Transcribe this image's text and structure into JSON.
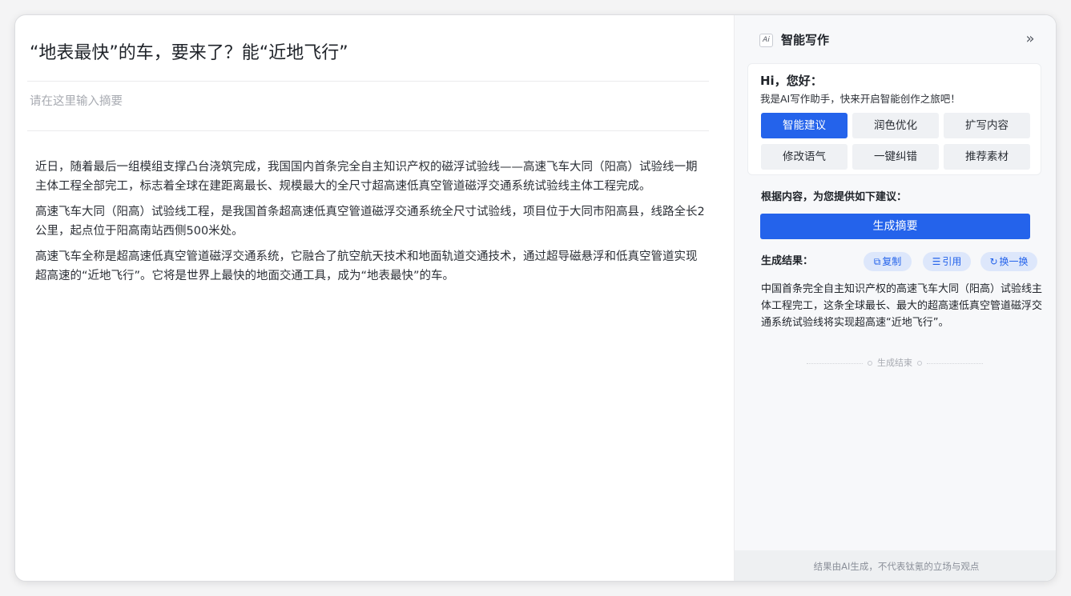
{
  "editor": {
    "title": "“地表最快”的车，要来了？能“近地飞行”",
    "abstract_placeholder": "请在这里输入摘要",
    "paragraphs": [
      "近日，随着最后一组模组支撑凸台浇筑完成，我国国内首条完全自主知识产权的磁浮试验线——高速飞车大同（阳高）试验线一期主体工程全部完工，标志着全球在建距离最长、规模最大的全尺寸超高速低真空管道磁浮交通系统试验线主体工程完成。",
      "高速飞车大同（阳高）试验线工程，是我国首条超高速低真空管道磁浮交通系统全尺寸试验线，项目位于大同市阳高县，线路全长2公里，起点位于阳高南站西侧500米处。",
      "高速飞车全称是超高速低真空管道磁浮交通系统，它融合了航空航天技术和地面轨道交通技术，通过超导磁悬浮和低真空管道实现超高速的“近地飞行”。它将是世界上最快的地面交通工具，成为“地表最快”的车。"
    ]
  },
  "panel": {
    "logo_text": "Ai",
    "title": "智能写作",
    "collapse_glyph": "»",
    "greeting": {
      "title": "Hi，您好：",
      "subtitle": "我是AI写作助手，快来开启智能创作之旅吧！"
    },
    "options": [
      {
        "label": "智能建议",
        "active": true
      },
      {
        "label": "润色优化",
        "active": false
      },
      {
        "label": "扩写内容",
        "active": false
      },
      {
        "label": "修改语气",
        "active": false
      },
      {
        "label": "一键纠错",
        "active": false
      },
      {
        "label": "推荐素材",
        "active": false
      }
    ],
    "suggest_label": "根据内容，为您提供如下建议：",
    "generate_button": "生成摘要",
    "result_label": "生成结果：",
    "actions": {
      "copy": "复制",
      "quote": "引用",
      "refresh": "换一换"
    },
    "result_text": "中国首条完全自主知识产权的高速飞车大同（阳高）试验线主体工程完工，这条全球最长、最大的超高速低真空管道磁浮交通系统试验线将实现超高速“近地飞行”。",
    "end_marker": "生成结束",
    "footer": "结果由AI生成，不代表钛氪的立场与观点"
  },
  "colors": {
    "accent": "#2463eb",
    "accent_light": "#dde7fb",
    "placeholder": "#a8abb2"
  }
}
